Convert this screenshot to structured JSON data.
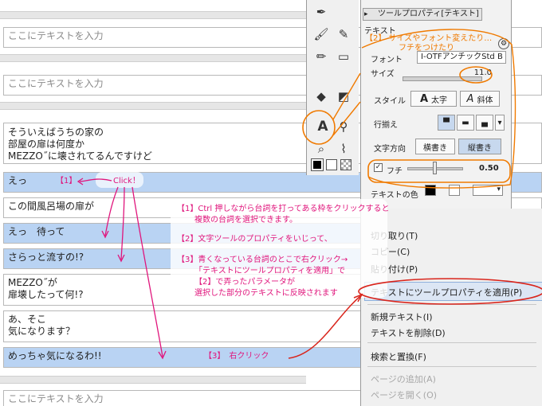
{
  "text_list": {
    "rows": [
      {
        "lines": [
          "ここにテキストを入力"
        ],
        "placeholder": true,
        "selected": false
      },
      {
        "lines": [
          "ここにテキストを入力"
        ],
        "placeholder": true,
        "selected": false
      },
      {
        "lines": [
          "そういえばうちの家の",
          "部屋の扉は何度か",
          "MEZZO˝に壊されてるんですけど"
        ],
        "placeholder": false,
        "selected": false
      },
      {
        "lines": [
          "えっ"
        ],
        "placeholder": false,
        "selected": true
      },
      {
        "lines": [
          "この間風呂場の扉が"
        ],
        "placeholder": false,
        "selected": false
      },
      {
        "lines": [
          "えっ　待って"
        ],
        "placeholder": false,
        "selected": true
      },
      {
        "lines": [
          "さらっと流すの!?"
        ],
        "placeholder": false,
        "selected": true
      },
      {
        "lines": [
          "MEZZO˝が",
          "扉壊したって何!?"
        ],
        "placeholder": false,
        "selected": false
      },
      {
        "lines": [
          "あ、そこ",
          "気になります？"
        ],
        "placeholder": false,
        "selected": false
      },
      {
        "lines": [
          "めっちゃ気になるわ!!"
        ],
        "placeholder": false,
        "selected": true
      },
      {
        "lines": [
          "ここにテキストを入力"
        ],
        "placeholder": true,
        "selected": false
      }
    ]
  },
  "tool_property": {
    "tab_title": "ツールプロパティ[テキスト]",
    "tool_name": "テキスト",
    "font_label": "フォント",
    "font_value": "I-OTFアンチックStd B",
    "size_label": "サイズ",
    "size_value": "11.0",
    "style_label": "スタイル",
    "bold_label": "太字",
    "italic_label": "斜体",
    "align_label": "行揃え",
    "direction_label": "文字方向",
    "horizontal_label": "横書き",
    "vertical_label": "縦書き",
    "edge_label": "フチ",
    "edge_value": "0.50",
    "edge_checked": true,
    "text_color_label": "テキストの色"
  },
  "context_menu": {
    "items": [
      {
        "label": "切り取り(T)",
        "enabled": true,
        "highlighted": false
      },
      {
        "label": "コピー(C)",
        "enabled": true,
        "highlighted": false
      },
      {
        "label": "貼り付け(P)",
        "enabled": true,
        "highlighted": false
      },
      {
        "label": "テキストにツールプロパティを適用(P)",
        "enabled": true,
        "highlighted": true
      },
      {
        "label": "新規テキスト(I)",
        "enabled": true,
        "highlighted": false
      },
      {
        "label": "テキストを削除(D)",
        "enabled": true,
        "highlighted": false
      },
      {
        "label": "検索と置換(F)",
        "enabled": true,
        "highlighted": false
      },
      {
        "label": "ページの追加(A)",
        "enabled": false,
        "highlighted": false
      },
      {
        "label": "ページを開く(O)",
        "enabled": false,
        "highlighted": false
      }
    ]
  },
  "annotations": {
    "step1_tag": "【1】",
    "click_label": "Click！",
    "step1_line1": "【1】Ctrl 押しながら台詞を打ってある枠をクリックすると",
    "step1_line2": "複数の台詞を選択できます。",
    "step2_line": "【2】文字ツールのプロパティをいじって、",
    "step3_line1": "【3】青くなっている台詞のとこで右クリック→",
    "step3_line2": "「テキストにツールプロパティを適用」で",
    "step3_line3": "【2】で弄ったパラメータが",
    "step3_line4": "選択した部分のテキストに反映されます",
    "step3_tag": "【3】　右クリック",
    "panel_note_line1": "【2】 サイズやフォント変えたり…",
    "panel_note_line2": "フチをつけたり"
  },
  "colors": {
    "selected_row": "#b9d3f3",
    "annotation_pink": "#e0157c",
    "annotation_orange": "#f07a00",
    "annotation_red": "#d9251c"
  }
}
